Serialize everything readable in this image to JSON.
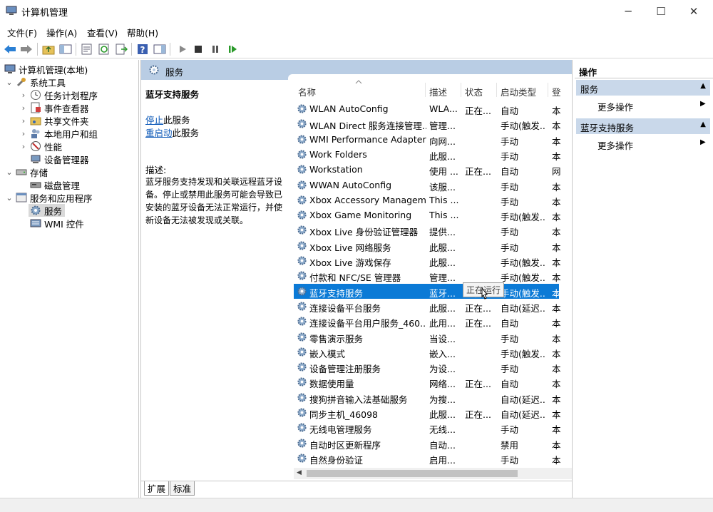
{
  "window": {
    "title": "计算机管理",
    "controls": {
      "minimize": "─",
      "maximize": "☐",
      "close": "✕"
    }
  },
  "menu": [
    "文件(F)",
    "操作(A)",
    "查看(V)",
    "帮助(H)"
  ],
  "tree": {
    "root": "计算机管理(本地)",
    "system_tools": "系统工具",
    "task_scheduler": "任务计划程序",
    "event_viewer": "事件查看器",
    "shared_folders": "共享文件夹",
    "local_users": "本地用户和组",
    "performance": "性能",
    "device_manager": "设备管理器",
    "storage": "存储",
    "disk_management": "磁盘管理",
    "services_apps": "服务和应用程序",
    "services": "服务",
    "wmi": "WMI 控件"
  },
  "center": {
    "header": "服务",
    "selected_name": "蓝牙支持服务",
    "stop_link": "停止",
    "stop_suffix": "此服务",
    "restart_link": "重启动",
    "restart_suffix": "此服务",
    "desc_label": "描述:",
    "description": "蓝牙服务支持发现和关联远程蓝牙设备。停止或禁用此服务可能会导致已安装的蓝牙设备无法正常运行，并使新设备无法被发现或关联。",
    "columns": {
      "name": "名称",
      "desc": "描述",
      "status": "状态",
      "startup": "启动类型",
      "logon": "登"
    },
    "tooltip": "正在运行",
    "tabs": {
      "extended": "扩展",
      "standard": "标准"
    }
  },
  "services": [
    {
      "name": "WLAN AutoConfig",
      "desc": "WLA...",
      "status": "正在...",
      "startup": "自动",
      "logon": "本"
    },
    {
      "name": "WLAN Direct 服务连接管理...",
      "desc": "管理...",
      "status": "",
      "startup": "手动(触发...",
      "logon": "本"
    },
    {
      "name": "WMI Performance Adapter",
      "desc": "向网...",
      "status": "",
      "startup": "手动",
      "logon": "本"
    },
    {
      "name": "Work Folders",
      "desc": "此服...",
      "status": "",
      "startup": "手动",
      "logon": "本"
    },
    {
      "name": "Workstation",
      "desc": "使用 ...",
      "status": "正在...",
      "startup": "自动",
      "logon": "网"
    },
    {
      "name": "WWAN AutoConfig",
      "desc": "该服...",
      "status": "",
      "startup": "手动",
      "logon": "本"
    },
    {
      "name": "Xbox Accessory Managem...",
      "desc": "This ...",
      "status": "",
      "startup": "手动",
      "logon": "本"
    },
    {
      "name": "Xbox Game Monitoring",
      "desc": "This ...",
      "status": "",
      "startup": "手动(触发...",
      "logon": "本"
    },
    {
      "name": "Xbox Live 身份验证管理器",
      "desc": "提供...",
      "status": "",
      "startup": "手动",
      "logon": "本"
    },
    {
      "name": "Xbox Live 网络服务",
      "desc": "此服...",
      "status": "",
      "startup": "手动",
      "logon": "本"
    },
    {
      "name": "Xbox Live 游戏保存",
      "desc": "此服...",
      "status": "",
      "startup": "手动(触发...",
      "logon": "本"
    },
    {
      "name": "付款和 NFC/SE 管理器",
      "desc": "管理...",
      "status": "",
      "startup": "手动(触发...",
      "logon": "本"
    },
    {
      "name": "蓝牙支持服务",
      "desc": "蓝牙...",
      "status": "正在...",
      "startup": "手动(触发...",
      "logon": "本",
      "selected": true
    },
    {
      "name": "连接设备平台服务",
      "desc": "此服...",
      "status": "正在...",
      "startup": "自动(延迟...",
      "logon": "本"
    },
    {
      "name": "连接设备平台用户服务_460...",
      "desc": "此用...",
      "status": "正在...",
      "startup": "自动",
      "logon": "本"
    },
    {
      "name": "零售演示服务",
      "desc": "当设...",
      "status": "",
      "startup": "手动",
      "logon": "本"
    },
    {
      "name": "嵌入模式",
      "desc": "嵌入...",
      "status": "",
      "startup": "手动(触发...",
      "logon": "本"
    },
    {
      "name": "设备管理注册服务",
      "desc": "为设...",
      "status": "",
      "startup": "手动",
      "logon": "本"
    },
    {
      "name": "数据使用量",
      "desc": "网络...",
      "status": "正在...",
      "startup": "自动",
      "logon": "本"
    },
    {
      "name": "搜狗拼音输入法基础服务",
      "desc": "为搜...",
      "status": "",
      "startup": "自动(延迟...",
      "logon": "本"
    },
    {
      "name": "同步主机_46098",
      "desc": "此服...",
      "status": "正在...",
      "startup": "自动(延迟...",
      "logon": "本"
    },
    {
      "name": "无线电管理服务",
      "desc": "无线...",
      "status": "",
      "startup": "手动",
      "logon": "本"
    },
    {
      "name": "自动时区更新程序",
      "desc": "自动...",
      "status": "",
      "startup": "禁用",
      "logon": "本"
    },
    {
      "name": "自然身份验证",
      "desc": "启用...",
      "status": "",
      "startup": "手动",
      "logon": "本"
    }
  ],
  "actions": {
    "title": "操作",
    "section1": "服务",
    "section1_item": "更多操作",
    "section2": "蓝牙支持服务",
    "section2_item": "更多操作"
  },
  "colors": {
    "accent": "#0b7ad6",
    "header": "#b9cde4",
    "section": "#c9d8ea"
  }
}
